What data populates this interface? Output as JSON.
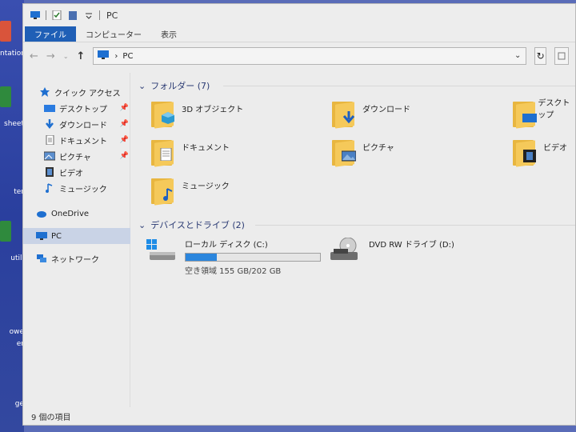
{
  "desktop": {
    "labels": [
      "ntation",
      "sheet",
      "ter",
      "utili",
      "owe",
      "er",
      "ge"
    ]
  },
  "window": {
    "title": "PC",
    "ribbon_tabs": [
      "ファイル",
      "コンピューター",
      "表示"
    ],
    "address": "PC",
    "address_separator": "›"
  },
  "nav_pane": {
    "quick_access": "クイック アクセス",
    "quick_items": [
      {
        "label": "デスクトップ",
        "pinned": true
      },
      {
        "label": "ダウンロード",
        "pinned": true
      },
      {
        "label": "ドキュメント",
        "pinned": true
      },
      {
        "label": "ピクチャ",
        "pinned": true
      },
      {
        "label": "ビデオ",
        "pinned": false
      },
      {
        "label": "ミュージック",
        "pinned": false
      }
    ],
    "onedrive": "OneDrive",
    "pc": "PC",
    "network": "ネットワーク"
  },
  "groups": {
    "folders_header": "フォルダー (7)",
    "drives_header": "デバイスとドライブ (2)"
  },
  "folders": [
    {
      "label": "3D オブジェクト",
      "icon": "3d-objects-icon"
    },
    {
      "label": "ダウンロード",
      "icon": "download-arrow-icon"
    },
    {
      "label": "デスクトップ",
      "icon": "desktop-icon"
    },
    {
      "label": "ドキュメント",
      "icon": "document-icon"
    },
    {
      "label": "ピクチャ",
      "icon": "picture-icon"
    },
    {
      "label": "ビデオ",
      "icon": "video-icon"
    },
    {
      "label": "ミュージック",
      "icon": "music-icon"
    }
  ],
  "drives": [
    {
      "label": "ローカル ディスク (C:)",
      "free_text": "空き領域 155 GB/202 GB",
      "used_fraction": 0.23
    },
    {
      "label": "DVD RW ドライブ (D:)"
    }
  ],
  "status": {
    "item_count": "9 個の項目"
  },
  "colors": {
    "accent": "#1f5fb6",
    "folder": "#f5c95a",
    "selection": "#c9d3e6",
    "drive_fill": "#2b86dd"
  }
}
